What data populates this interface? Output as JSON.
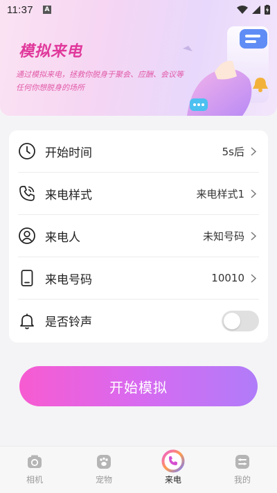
{
  "status_bar": {
    "time": "11:37",
    "notification_badge": "A"
  },
  "banner": {
    "title": "模拟来电",
    "subtitle": "通过模拟来电，拯救你脱身于聚会、应酬、会议等任何你想脱身的场所"
  },
  "settings": {
    "rows": [
      {
        "label": "开始时间",
        "value": "5s后",
        "icon": "clock-icon"
      },
      {
        "label": "来电样式",
        "value": "来电样式1",
        "icon": "phone-call-icon"
      },
      {
        "label": "来电人",
        "value": "未知号码",
        "icon": "person-icon"
      },
      {
        "label": "来电号码",
        "value": "10010",
        "icon": "mobile-phone-icon"
      }
    ],
    "ringtone": {
      "label": "是否铃声",
      "enabled": false,
      "icon": "bell-icon"
    }
  },
  "start_button": {
    "label": "开始模拟"
  },
  "bottom_nav": {
    "items": [
      {
        "label": "相机",
        "icon": "camera-icon",
        "active": false
      },
      {
        "label": "宠物",
        "icon": "paw-icon",
        "active": false
      },
      {
        "label": "来电",
        "icon": "phone-call-icon",
        "active": true
      },
      {
        "label": "我的",
        "icon": "profile-icon",
        "active": false
      }
    ]
  },
  "colors": {
    "accent_pink": "#e0389b",
    "button_start": "#f75bd1",
    "button_end": "#b07cf9"
  }
}
